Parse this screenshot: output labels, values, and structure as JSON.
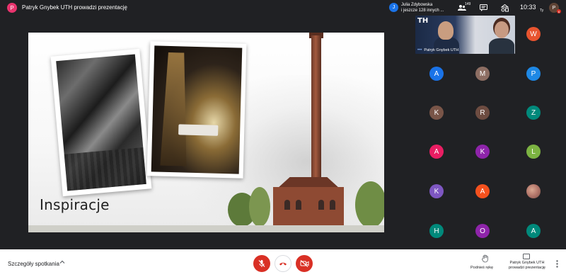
{
  "presentation_bar": {
    "avatar_letter": "P",
    "title": "Patryk Gnybek UTH prowadzi prezentację"
  },
  "viewers": {
    "avatar_letter": "J",
    "line1": "Julia Zdybowska",
    "line2": "i jeszcze 128 innych ..."
  },
  "toolbar": {
    "people_count": "149",
    "people_icon": "people-icon",
    "chat_icon": "chat-icon",
    "activities_icon": "activities-icon",
    "clock": "10:33",
    "you_label": "Ty",
    "self_avatar_letter": "P",
    "self_badge": "6"
  },
  "slide": {
    "title": "Inspiracje"
  },
  "video_tile": {
    "logo_text": "TH",
    "name": "Patryk Gnybek UTH"
  },
  "participants": [
    {
      "letter": "W",
      "color": "#e8542f"
    },
    {
      "letter": "A",
      "color": "#1a73e8"
    },
    {
      "letter": "M",
      "color": "#8d6e63"
    },
    {
      "letter": "P",
      "color": "#1e88e5"
    },
    {
      "letter": "K",
      "color": "#795548"
    },
    {
      "letter": "R",
      "color": "#6d4c41"
    },
    {
      "letter": "Z",
      "color": "#00897b"
    },
    {
      "letter": "A",
      "color": "#e91e63"
    },
    {
      "letter": "K",
      "color": "#8e24aa"
    },
    {
      "letter": "L",
      "color": "#7cb342"
    },
    {
      "letter": "K",
      "color": "#7e57c2"
    },
    {
      "letter": "A",
      "color": "#f4511e"
    },
    {
      "letter": "",
      "color": "photo"
    },
    {
      "letter": "H",
      "color": "#00897b"
    },
    {
      "letter": "O",
      "color": "#8e24aa"
    },
    {
      "letter": "A",
      "color": "#00897b"
    }
  ],
  "bottom": {
    "details_label": "Szczegóły spotkania",
    "raise_hand_label": "Podnieś rękę",
    "presenting_label": "Patryk Gnybek UTH prowadzi prezentację"
  }
}
